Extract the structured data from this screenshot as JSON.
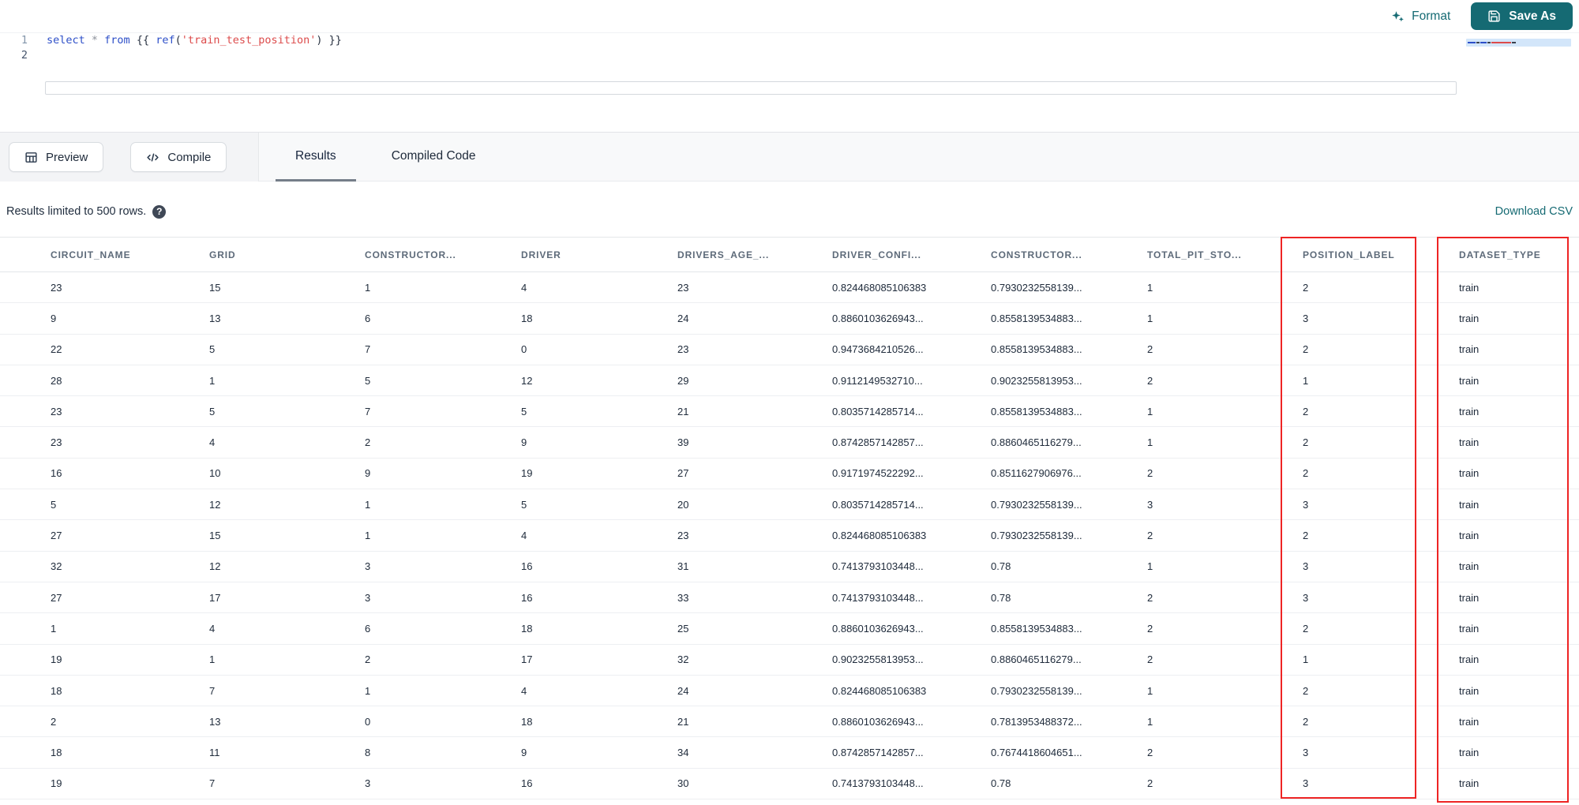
{
  "colors": {
    "accent_teal": "#156a73",
    "annotation_red": "#ee2424",
    "keyword_blue": "#2d4fc8",
    "string_red": "#dc4b4b"
  },
  "topbar": {
    "format_label": "Format",
    "save_as_label": "Save As"
  },
  "icons": {
    "format": "sparkles-icon",
    "save": "floppy-disk-icon",
    "preview": "table-grid-icon",
    "compile": "code-brackets-icon",
    "help": "question-mark-icon"
  },
  "editor": {
    "line_numbers": [
      "1",
      "2"
    ],
    "tokens": [
      {
        "text": "select "
      },
      {
        "text": "* "
      },
      {
        "text": "from "
      },
      {
        "text": "{{ "
      },
      {
        "text": "ref"
      },
      {
        "text": "("
      },
      {
        "text": "'train_test_position'"
      },
      {
        "text": ") }}"
      }
    ]
  },
  "toolbar": {
    "preview_label": "Preview",
    "compile_label": "Compile",
    "tabs": [
      {
        "label": "Results",
        "active": true
      },
      {
        "label": "Compiled Code",
        "active": false
      }
    ]
  },
  "results_header": {
    "limit_text": "Results limited to 500 rows.",
    "help_glyph": "?",
    "download_label": "Download CSV"
  },
  "table": {
    "columns": [
      "CIRCUIT_NAME",
      "GRID",
      "CONSTRUCTOR...",
      "DRIVER",
      "DRIVERS_AGE_...",
      "DRIVER_CONFI...",
      "CONSTRUCTOR...",
      "TOTAL_PIT_STO...",
      "POSITION_LABEL",
      "DATASET_TYPE"
    ],
    "rows": [
      [
        "23",
        "15",
        "1",
        "4",
        "23",
        "0.824468085106383",
        "0.7930232558139...",
        "1",
        "2",
        "train"
      ],
      [
        "9",
        "13",
        "6",
        "18",
        "24",
        "0.8860103626943...",
        "0.8558139534883...",
        "1",
        "3",
        "train"
      ],
      [
        "22",
        "5",
        "7",
        "0",
        "23",
        "0.9473684210526...",
        "0.8558139534883...",
        "2",
        "2",
        "train"
      ],
      [
        "28",
        "1",
        "5",
        "12",
        "29",
        "0.9112149532710...",
        "0.9023255813953...",
        "2",
        "1",
        "train"
      ],
      [
        "23",
        "5",
        "7",
        "5",
        "21",
        "0.8035714285714...",
        "0.8558139534883...",
        "1",
        "2",
        "train"
      ],
      [
        "23",
        "4",
        "2",
        "9",
        "39",
        "0.8742857142857...",
        "0.8860465116279...",
        "1",
        "2",
        "train"
      ],
      [
        "16",
        "10",
        "9",
        "19",
        "27",
        "0.9171974522292...",
        "0.8511627906976...",
        "2",
        "2",
        "train"
      ],
      [
        "5",
        "12",
        "1",
        "5",
        "20",
        "0.8035714285714...",
        "0.7930232558139...",
        "3",
        "3",
        "train"
      ],
      [
        "27",
        "15",
        "1",
        "4",
        "23",
        "0.824468085106383",
        "0.7930232558139...",
        "2",
        "2",
        "train"
      ],
      [
        "32",
        "12",
        "3",
        "16",
        "31",
        "0.7413793103448...",
        "0.78",
        "1",
        "3",
        "train"
      ],
      [
        "27",
        "17",
        "3",
        "16",
        "33",
        "0.7413793103448...",
        "0.78",
        "2",
        "3",
        "train"
      ],
      [
        "1",
        "4",
        "6",
        "18",
        "25",
        "0.8860103626943...",
        "0.8558139534883...",
        "2",
        "2",
        "train"
      ],
      [
        "19",
        "1",
        "2",
        "17",
        "32",
        "0.9023255813953...",
        "0.8860465116279...",
        "2",
        "1",
        "train"
      ],
      [
        "18",
        "7",
        "1",
        "4",
        "24",
        "0.824468085106383",
        "0.7930232558139...",
        "1",
        "2",
        "train"
      ],
      [
        "2",
        "13",
        "0",
        "18",
        "21",
        "0.8860103626943...",
        "0.7813953488372...",
        "1",
        "2",
        "train"
      ],
      [
        "18",
        "11",
        "8",
        "9",
        "34",
        "0.8742857142857...",
        "0.7674418604651...",
        "2",
        "3",
        "train"
      ],
      [
        "19",
        "7",
        "3",
        "16",
        "30",
        "0.7413793103448...",
        "0.78",
        "2",
        "3",
        "train"
      ]
    ]
  },
  "annotations": {
    "position_label_box": "POSITION_LABEL column highlight",
    "dataset_type_box": "DATASET_TYPE column highlight"
  }
}
